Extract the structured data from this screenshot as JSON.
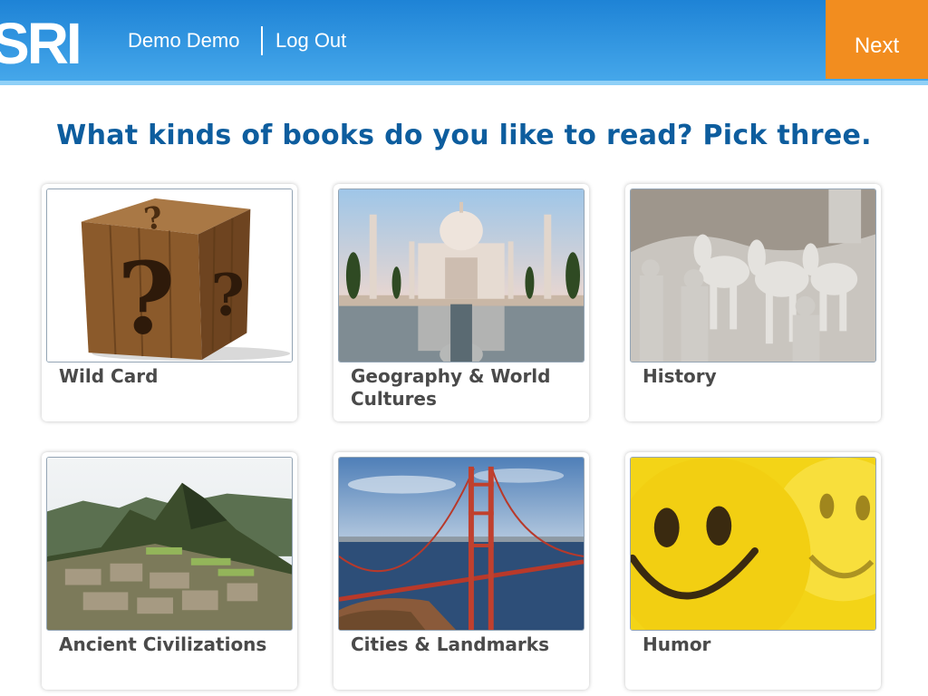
{
  "header": {
    "logo_text": "SRI",
    "user_name": "Demo Demo",
    "logout_label": "Log Out",
    "next_label": "Next"
  },
  "question": "What kinds of books do you like to read? Pick three.",
  "cards": [
    {
      "label": "Wild Card",
      "image": "wooden-question-box"
    },
    {
      "label": "Geography & World Cultures",
      "image": "taj-mahal"
    },
    {
      "label": "History",
      "image": "terracotta-army"
    },
    {
      "label": "Ancient Civilizations",
      "image": "machu-picchu"
    },
    {
      "label": "Cities & Landmarks",
      "image": "golden-gate-bridge"
    },
    {
      "label": "Humor",
      "image": "smiley-faces"
    }
  ]
}
